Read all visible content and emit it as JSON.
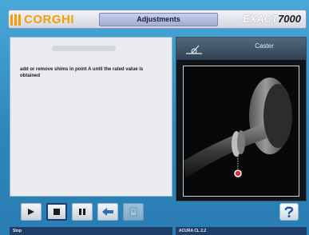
{
  "header": {
    "brand": "CORGHI",
    "title": "Adjustments",
    "model_prefix": "EXACT",
    "model_number": "7000"
  },
  "left_panel": {
    "instructions": "add or remove shims in point A until the rated value is obtained"
  },
  "right_panel": {
    "title": "Caster",
    "icon": "caster-angle-icon"
  },
  "toolbar": {
    "buttons": [
      {
        "icon": "play-icon"
      },
      {
        "icon": "stop-icon",
        "active": true
      },
      {
        "icon": "pause-icon"
      },
      {
        "icon": "back-arrow-icon"
      },
      {
        "icon": "page-icon",
        "disabled": true
      }
    ],
    "help_icon": "help-icon"
  },
  "status": {
    "left": "Stop",
    "right": "ACURA CL 2.2"
  },
  "colors": {
    "brand": "#f2a000",
    "background": "#2f8fc4",
    "statusbar": "#1f3f6a"
  }
}
